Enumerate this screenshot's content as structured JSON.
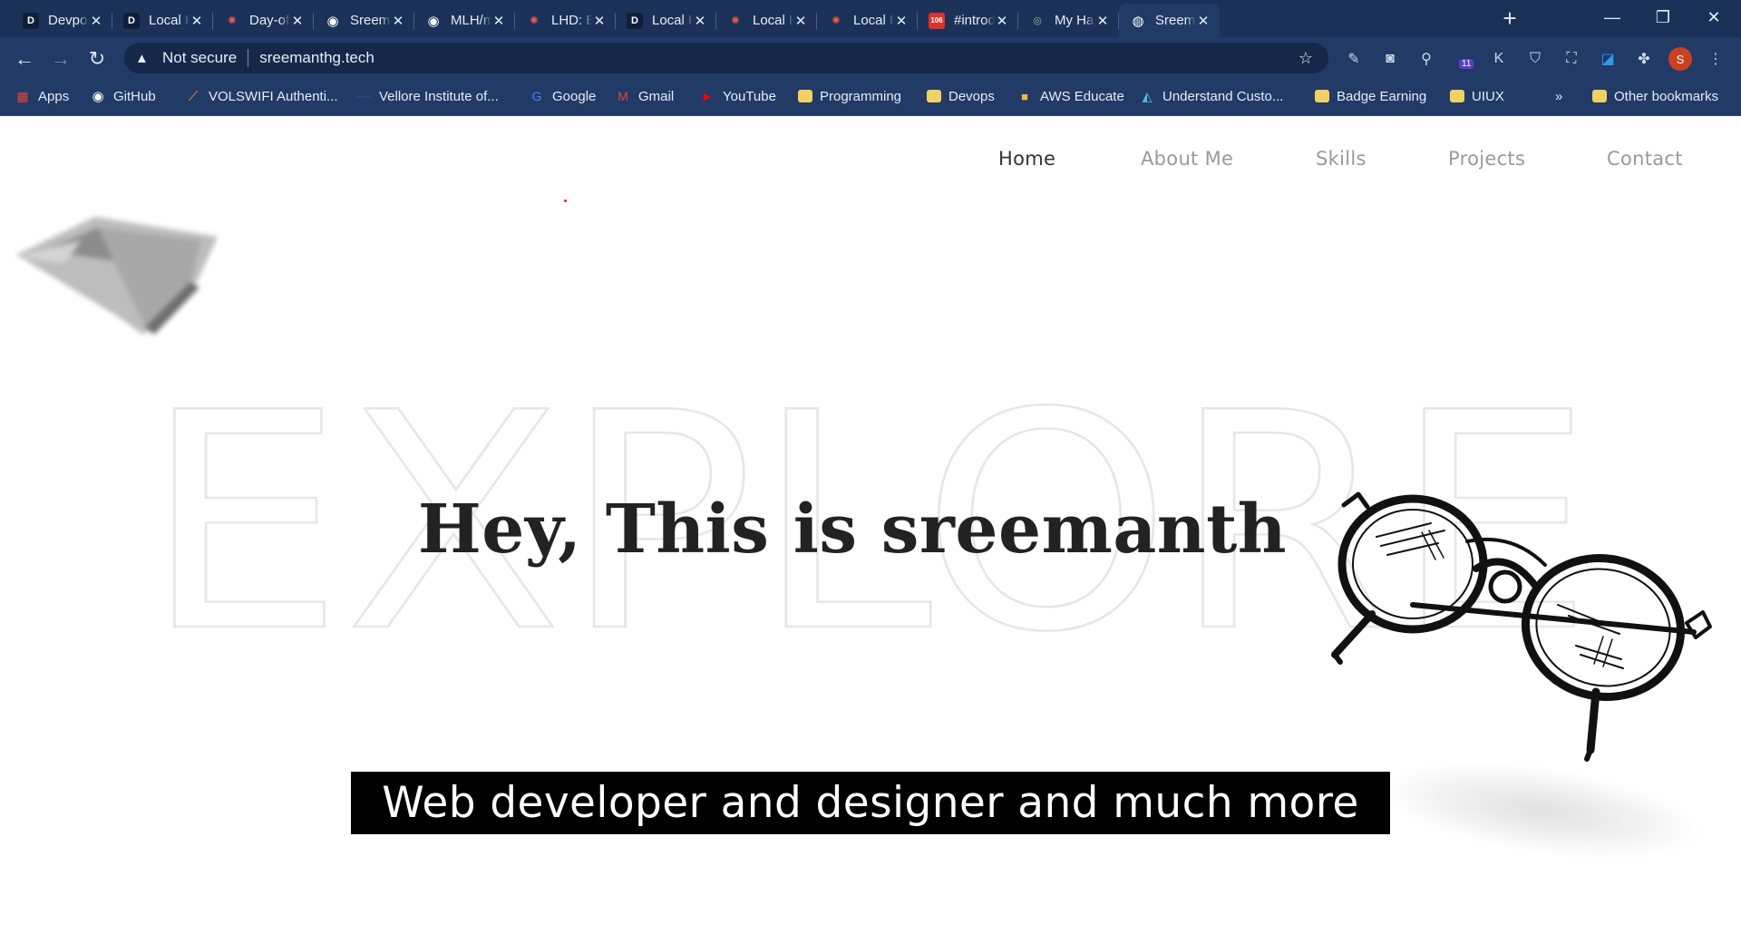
{
  "browser": {
    "tabs": [
      {
        "title": "Devpost",
        "favicon": "D",
        "favicon_icon": "devpost-icon"
      },
      {
        "title": "Local Hack",
        "favicon": "D",
        "favicon_icon": "devpost-icon"
      },
      {
        "title": "Day-of Hack",
        "favicon": "✺",
        "favicon_icon": "mlh-icon"
      },
      {
        "title": "Sreemanth",
        "favicon": "◉",
        "favicon_icon": "github-icon"
      },
      {
        "title": "MLH/mlh",
        "favicon": "◉",
        "favicon_icon": "github-icon"
      },
      {
        "title": "LHD: Build",
        "favicon": "✺",
        "favicon_icon": "mlh-icon"
      },
      {
        "title": "Local Hack",
        "favicon": "D",
        "favicon_icon": "devpost-icon"
      },
      {
        "title": "Local Hack",
        "favicon": "✺",
        "favicon_icon": "mlh-icon"
      },
      {
        "title": "Local Hack",
        "favicon": "✺",
        "favicon_icon": "mlh-icon"
      },
      {
        "title": "#introductions",
        "favicon": "106",
        "favicon_icon": "badge-icon"
      },
      {
        "title": "My Hackathons",
        "favicon": "◎",
        "favicon_icon": "hackathon-icon"
      },
      {
        "title": "Sreemanth",
        "favicon": "◍",
        "favicon_icon": "globe-icon"
      }
    ],
    "new_tab": "+",
    "window_controls": {
      "minimize": "—",
      "restore": "❐",
      "close": "✕"
    },
    "toolbar": {
      "back": "←",
      "forward": "→",
      "reload": "↻",
      "security_label": "Not secure",
      "url": "sreemanthg.tech",
      "star": "☆",
      "extension_badge": "11",
      "profile_initial": "S"
    },
    "bookmarks": [
      {
        "label": "Apps",
        "icon": "apps-grid-icon"
      },
      {
        "label": "GitHub",
        "icon": "github-icon"
      },
      {
        "label": "VOLSWIFI Authenti...",
        "icon": "wifi-flame-icon"
      },
      {
        "label": "Vellore Institute of...",
        "icon": "vit-icon"
      },
      {
        "label": "Google",
        "icon": "google-icon"
      },
      {
        "label": "Gmail",
        "icon": "gmail-icon"
      },
      {
        "label": "YouTube",
        "icon": "youtube-icon"
      },
      {
        "label": "Programming",
        "icon": "folder-icon"
      },
      {
        "label": "Devops",
        "icon": "folder-icon"
      },
      {
        "label": "AWS Educate",
        "icon": "aws-icon"
      },
      {
        "label": "Understand Custo...",
        "icon": "understand-icon"
      },
      {
        "label": "Badge Earning",
        "icon": "folder-icon"
      },
      {
        "label": "UIUX",
        "icon": "folder-icon"
      }
    ],
    "bookmarks_overflow": "»",
    "other_bookmarks": "Other bookmarks"
  },
  "site": {
    "nav": [
      "Home",
      "About Me",
      "Skills",
      "Projects",
      "Contact"
    ],
    "background_word": "EXPLORE",
    "hero_title": "Hey, This is sreemanth",
    "subtitle": "Web developer and designer and much more"
  },
  "colors": {
    "tabstrip": "#1c3158",
    "toolbar": "#213a66",
    "page_background": "#ffffff",
    "nav_active": "#333333",
    "nav_inactive": "#9a9a9a",
    "subtitle_bg": "#000000",
    "subtitle_text": "#ffffff"
  }
}
